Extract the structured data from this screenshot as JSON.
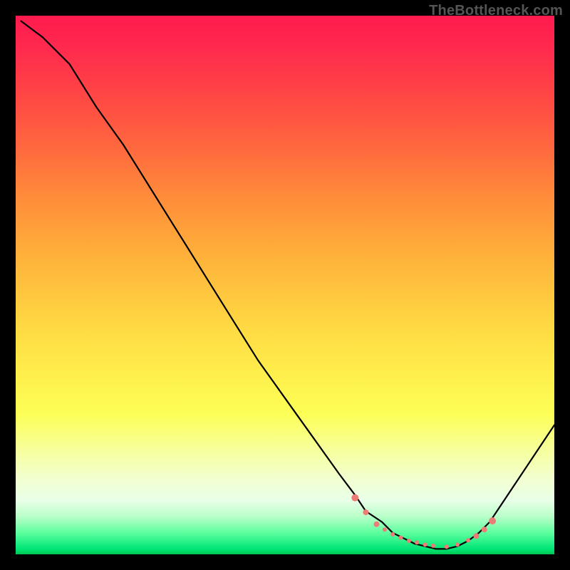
{
  "watermark": "TheBottleneck.com",
  "chart_data": {
    "type": "line",
    "title": "",
    "xlabel": "",
    "ylabel": "",
    "xlim": [
      0,
      100
    ],
    "ylim": [
      0,
      100
    ],
    "series": [
      {
        "name": "curve",
        "color": "#000000",
        "x": [
          1,
          5,
          10,
          15,
          20,
          25,
          30,
          35,
          40,
          45,
          50,
          55,
          60,
          63,
          65,
          68,
          70,
          72,
          74,
          76,
          78,
          80,
          82,
          84,
          86,
          88,
          90,
          100
        ],
        "y": [
          99,
          96,
          91,
          83,
          76,
          68,
          60,
          52,
          44,
          36,
          29,
          22,
          15,
          11,
          8,
          6,
          4,
          3,
          2,
          1.5,
          1,
          1,
          1.5,
          2.5,
          4,
          6,
          9,
          24
        ]
      },
      {
        "name": "markers",
        "color": "#ed7b76",
        "type": "scatter",
        "x": [
          63,
          65,
          67,
          68.5,
          70,
          71.5,
          73,
          74.5,
          76,
          77.5,
          80,
          82,
          84,
          85.5,
          87,
          88.5
        ],
        "y": [
          10.5,
          7.8,
          5.6,
          4.6,
          3.7,
          3.1,
          2.5,
          2.2,
          1.8,
          1.6,
          1.4,
          1.8,
          2.6,
          3.4,
          4.6,
          6.2
        ],
        "r": [
          5,
          4,
          4,
          3,
          3,
          3,
          3,
          3,
          3,
          3,
          3,
          3,
          3,
          4,
          4,
          5
        ]
      }
    ]
  }
}
